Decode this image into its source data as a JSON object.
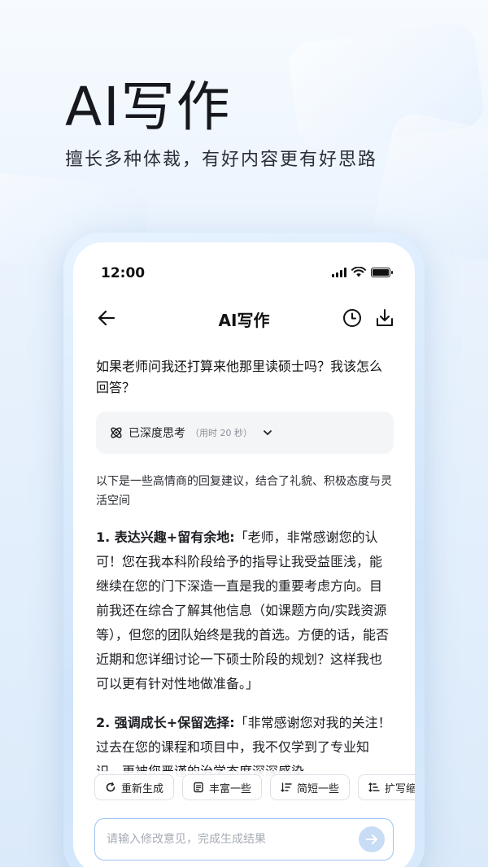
{
  "hero": {
    "title": "AI写作",
    "subtitle": "擅长多种体裁，有好内容更有好思路"
  },
  "status_bar": {
    "time": "12:00",
    "icons": [
      "signal-icon",
      "wifi-icon",
      "battery-icon"
    ]
  },
  "nav": {
    "title": "AI写作",
    "icons": [
      "back-arrow-icon",
      "history-clock-icon",
      "export-icon"
    ]
  },
  "chat": {
    "question": "如果老师问我还打算来他那里读硕士吗？我该怎么回答？",
    "thinking": {
      "label": "已深度思考",
      "time": "（用时 20 秒）",
      "icons": [
        "deep-think-icon",
        "chevron-down-icon"
      ]
    },
    "intro": "以下是一些高情商的回复建议，结合了礼貌、积极态度与灵活空间",
    "items": [
      {
        "heading": "1. 表达兴趣+留有余地:",
        "body": "「老师，非常感谢您的认可！您在我本科阶段给予的指导让我受益匪浅，能继续在您的门下深造一直是我的重要考虑方向。目前我还在综合了解其他信息（如课题方向/实践资源等），但您的团队始终是我的首选。方便的话，能否近期和您详细讨论一下硕士阶段的规划？这样我也可以更有针对性地做准备。」"
      },
      {
        "heading": "2. 强调成长+保留选择:",
        "body": "「非常感谢您对我的关注！过去在您的课程和项目中，我不仅学到了专业知识，更被您严谨的治学态度深深感染。"
      }
    ]
  },
  "actions": [
    {
      "label": "重新生成",
      "icon": "regenerate-icon"
    },
    {
      "label": "丰富一些",
      "icon": "enrich-icon"
    },
    {
      "label": "简短一些",
      "icon": "shorten-icon"
    },
    {
      "label": "扩写缩",
      "icon": "expand-icon"
    }
  ],
  "input": {
    "placeholder": "请输入修改意见，完成生成结果",
    "value": ""
  },
  "colors": {
    "accent": "#9cc3f2",
    "send_button": "#c9dcf5",
    "background": "#eaf3fd"
  }
}
